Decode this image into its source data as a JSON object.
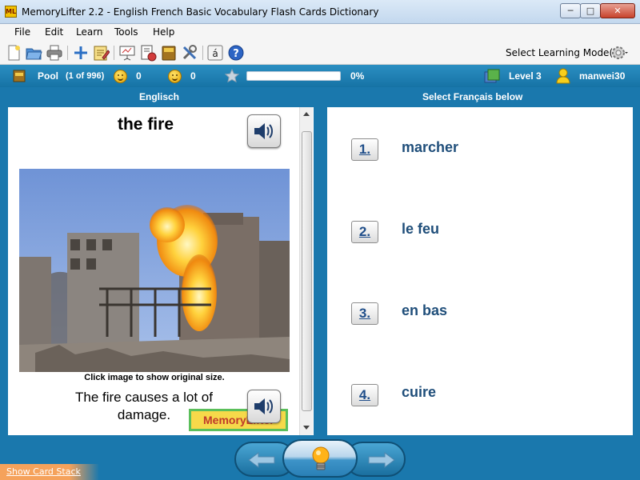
{
  "window": {
    "title": "MemoryLifter 2.2 - English French Basic Vocabulary Flash Cards Dictionary",
    "app_icon_text": "ML",
    "minimize_glyph": "─",
    "maximize_glyph": "□",
    "close_glyph": "✕"
  },
  "menu": [
    "File",
    "Edit",
    "Learn",
    "Tools",
    "Help"
  ],
  "toolbar": {
    "mode_label": "Select Learning Mode(s)",
    "accent_char": "á",
    "help_char": "?"
  },
  "status": {
    "pool_label": "Pool",
    "pool_count": "(1 of 996)",
    "correct_count": "0",
    "wrong_count": "0",
    "progress": 0,
    "progress_text": "0%",
    "level": "Level 3",
    "user": "manwei30"
  },
  "question_pane": {
    "header": "Englisch",
    "word": "the fire",
    "caption": "Click image to show original size.",
    "example": "The fire causes a lot of damage.",
    "badge": "MemoryLifter"
  },
  "answer_pane": {
    "header": "Select Français below",
    "choices": [
      {
        "number": "1.",
        "text": "marcher"
      },
      {
        "number": "2.",
        "text": "le feu"
      },
      {
        "number": "3.",
        "text": "en bas"
      },
      {
        "number": "4.",
        "text": "cuire"
      }
    ]
  },
  "footer": {
    "show_stack": "Show Card Stack"
  },
  "colors": {
    "frame_blue": "#1a78ad",
    "choice_text": "#1f4e7a",
    "stack_orange": "#f5a25b"
  }
}
